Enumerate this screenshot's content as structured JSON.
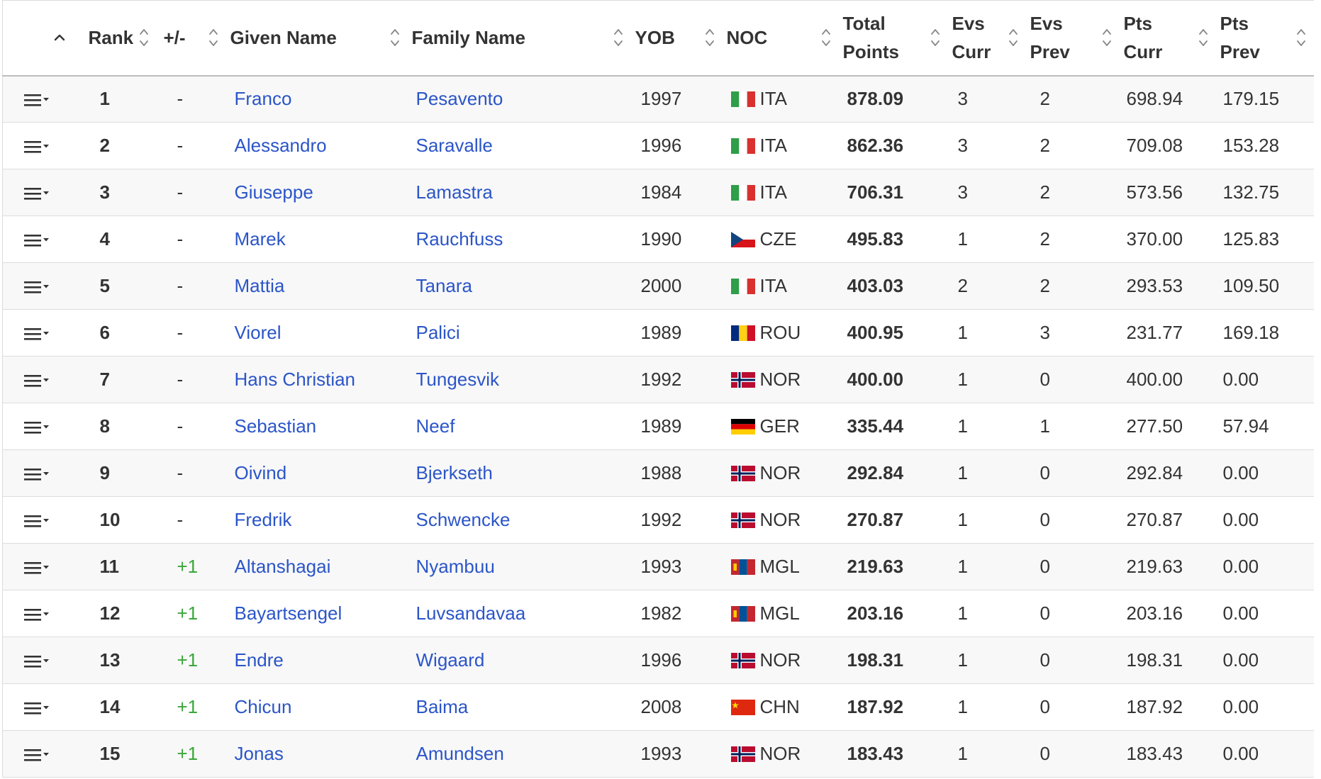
{
  "headers": {
    "rank": "Rank",
    "change": "+/-",
    "given_name": "Given Name",
    "family_name": "Family Name",
    "yob": "YOB",
    "noc": "NOC",
    "total_points": "Total Points",
    "evs_curr": "Evs Curr",
    "evs_prev": "Evs Prev",
    "pts_curr": "Pts Curr",
    "pts_prev": "Pts Prev"
  },
  "icons": {
    "row_menu": "hamburger-dropdown-icon",
    "sort": "sort-updown-icon",
    "collapse": "chevron-up-icon"
  },
  "colors": {
    "link": "#2b55c8",
    "positive_change": "#3aa63a",
    "row_stripe": "#f8f8f8"
  },
  "rows": [
    {
      "rank": "1",
      "change": "-",
      "given": "Franco",
      "family": "Pesavento",
      "yob": "1997",
      "noc": "ITA",
      "flag": "ita",
      "total": "878.09",
      "evs_curr": "3",
      "evs_prev": "2",
      "pts_curr": "698.94",
      "pts_prev": "179.15"
    },
    {
      "rank": "2",
      "change": "-",
      "given": "Alessandro",
      "family": "Saravalle",
      "yob": "1996",
      "noc": "ITA",
      "flag": "ita",
      "total": "862.36",
      "evs_curr": "3",
      "evs_prev": "2",
      "pts_curr": "709.08",
      "pts_prev": "153.28"
    },
    {
      "rank": "3",
      "change": "-",
      "given": "Giuseppe",
      "family": "Lamastra",
      "yob": "1984",
      "noc": "ITA",
      "flag": "ita",
      "total": "706.31",
      "evs_curr": "3",
      "evs_prev": "2",
      "pts_curr": "573.56",
      "pts_prev": "132.75"
    },
    {
      "rank": "4",
      "change": "-",
      "given": "Marek",
      "family": "Rauchfuss",
      "yob": "1990",
      "noc": "CZE",
      "flag": "cze",
      "total": "495.83",
      "evs_curr": "1",
      "evs_prev": "2",
      "pts_curr": "370.00",
      "pts_prev": "125.83"
    },
    {
      "rank": "5",
      "change": "-",
      "given": "Mattia",
      "family": "Tanara",
      "yob": "2000",
      "noc": "ITA",
      "flag": "ita",
      "total": "403.03",
      "evs_curr": "2",
      "evs_prev": "2",
      "pts_curr": "293.53",
      "pts_prev": "109.50"
    },
    {
      "rank": "6",
      "change": "-",
      "given": "Viorel",
      "family": "Palici",
      "yob": "1989",
      "noc": "ROU",
      "flag": "rou",
      "total": "400.95",
      "evs_curr": "1",
      "evs_prev": "3",
      "pts_curr": "231.77",
      "pts_prev": "169.18"
    },
    {
      "rank": "7",
      "change": "-",
      "given": "Hans Christian",
      "family": "Tungesvik",
      "yob": "1992",
      "noc": "NOR",
      "flag": "nor",
      "total": "400.00",
      "evs_curr": "1",
      "evs_prev": "0",
      "pts_curr": "400.00",
      "pts_prev": "0.00"
    },
    {
      "rank": "8",
      "change": "-",
      "given": "Sebastian",
      "family": "Neef",
      "yob": "1989",
      "noc": "GER",
      "flag": "ger",
      "total": "335.44",
      "evs_curr": "1",
      "evs_prev": "1",
      "pts_curr": "277.50",
      "pts_prev": "57.94"
    },
    {
      "rank": "9",
      "change": "-",
      "given": "Oivind",
      "family": "Bjerkseth",
      "yob": "1988",
      "noc": "NOR",
      "flag": "nor",
      "total": "292.84",
      "evs_curr": "1",
      "evs_prev": "0",
      "pts_curr": "292.84",
      "pts_prev": "0.00"
    },
    {
      "rank": "10",
      "change": "-",
      "given": "Fredrik",
      "family": "Schwencke",
      "yob": "1992",
      "noc": "NOR",
      "flag": "nor",
      "total": "270.87",
      "evs_curr": "1",
      "evs_prev": "0",
      "pts_curr": "270.87",
      "pts_prev": "0.00"
    },
    {
      "rank": "11",
      "change": "+1",
      "given": "Altanshagai",
      "family": "Nyambuu",
      "yob": "1993",
      "noc": "MGL",
      "flag": "mgl",
      "total": "219.63",
      "evs_curr": "1",
      "evs_prev": "0",
      "pts_curr": "219.63",
      "pts_prev": "0.00"
    },
    {
      "rank": "12",
      "change": "+1",
      "given": "Bayartsengel",
      "family": "Luvsandavaa",
      "yob": "1982",
      "noc": "MGL",
      "flag": "mgl",
      "total": "203.16",
      "evs_curr": "1",
      "evs_prev": "0",
      "pts_curr": "203.16",
      "pts_prev": "0.00"
    },
    {
      "rank": "13",
      "change": "+1",
      "given": "Endre",
      "family": "Wigaard",
      "yob": "1996",
      "noc": "NOR",
      "flag": "nor",
      "total": "198.31",
      "evs_curr": "1",
      "evs_prev": "0",
      "pts_curr": "198.31",
      "pts_prev": "0.00"
    },
    {
      "rank": "14",
      "change": "+1",
      "given": "Chicun",
      "family": "Baima",
      "yob": "2008",
      "noc": "CHN",
      "flag": "chn",
      "total": "187.92",
      "evs_curr": "1",
      "evs_prev": "0",
      "pts_curr": "187.92",
      "pts_prev": "0.00"
    },
    {
      "rank": "15",
      "change": "+1",
      "given": "Jonas",
      "family": "Amundsen",
      "yob": "1993",
      "noc": "NOR",
      "flag": "nor",
      "total": "183.43",
      "evs_curr": "1",
      "evs_prev": "0",
      "pts_curr": "183.43",
      "pts_prev": "0.00"
    }
  ]
}
